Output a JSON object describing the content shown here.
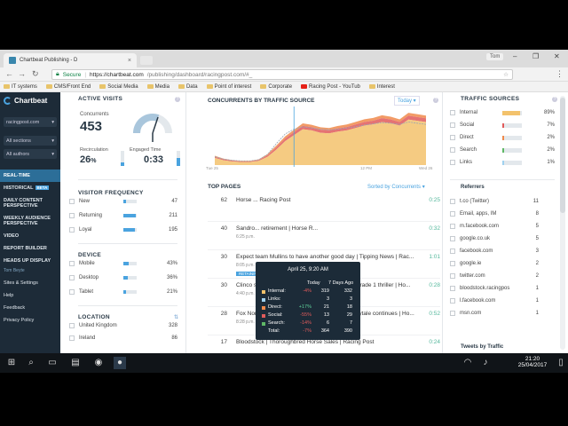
{
  "browser": {
    "tab_title": "Chartbeat Publishing - D",
    "profile": "Tom",
    "secure_label": "Secure",
    "url_domain": "https://chartbeat.com",
    "url_path": "/publishing/dashboard/racingpost.com/#_",
    "bookmarks": [
      "IT systems",
      "CMS/Front End",
      "Social Media",
      "Media",
      "Data",
      "Point of interest",
      "Corporate",
      "Racing Post - YouTub",
      "Interest"
    ]
  },
  "nav": {
    "logo": "Chartbeat",
    "site_select": "racingpost.com",
    "sections_select": "All sections",
    "authors_select": "All authors",
    "items": {
      "realtime": "REAL-TIME",
      "historical": "HISTORICAL",
      "historical_badge": "BETA",
      "daily": "DAILY CONTENT PERSPECTIVE",
      "weekly": "WEEKLY AUDIENCE PERSPECTIVE",
      "video": "VIDEO",
      "report": "REPORT BUILDER",
      "headsup": "HEADS UP DISPLAY",
      "tourbeta": "Tom Beyte",
      "sites": "Sites & Settings",
      "help": "Help",
      "feedback": "Feedback",
      "privacy": "Privacy Policy"
    }
  },
  "active_visits": {
    "title": "ACTIVE VISITS",
    "concurrents_label": "Concurrents",
    "concurrents": "453",
    "recirc_label": "Recirculation",
    "recirc": "26",
    "recirc_unit": "%",
    "engaged_label": "Engaged Time",
    "engaged": "0:33",
    "recirc_level": 0.26,
    "engaged_level": 0.55
  },
  "visitor_frequency": {
    "title": "VISITOR FREQUENCY",
    "rows": [
      {
        "label": "New",
        "value": "47",
        "level": 0.22
      },
      {
        "label": "Returning",
        "value": "211",
        "level": 0.95
      },
      {
        "label": "Loyal",
        "value": "195",
        "level": 0.88
      }
    ]
  },
  "device": {
    "title": "DEVICE",
    "rows": [
      {
        "label": "Mobile",
        "value": "43%",
        "level": 0.43
      },
      {
        "label": "Desktop",
        "value": "36%",
        "level": 0.36
      },
      {
        "label": "Tablet",
        "value": "21%",
        "level": 0.21
      }
    ]
  },
  "location": {
    "title": "LOCATION",
    "rows": [
      {
        "label": "United Kingdom",
        "value": "328"
      },
      {
        "label": "Ireland",
        "value": "86"
      }
    ]
  },
  "chart": {
    "title": "CONCURRENTS BY TRAFFIC SOURCE",
    "range_select": "Today",
    "ticks": [
      "Tue 25",
      "12 PM",
      "Wed 26"
    ]
  },
  "chart_data": {
    "type": "area",
    "xlabel": "",
    "ylabel": "",
    "x": [
      0,
      1,
      2,
      3,
      4,
      5,
      6,
      7,
      8,
      9,
      10,
      11,
      12,
      13,
      14,
      15,
      16,
      17,
      18,
      19,
      20,
      21,
      22,
      23,
      24
    ],
    "series": [
      {
        "name": "Internal",
        "values": [
          60,
          40,
          30,
          25,
          25,
          35,
          70,
          130,
          200,
          250,
          300,
          290,
          270,
          265,
          280,
          290,
          310,
          330,
          340,
          360,
          350,
          330,
          380,
          370,
          360
        ]
      },
      {
        "name": "Social",
        "values": [
          10,
          8,
          6,
          5,
          5,
          7,
          12,
          18,
          22,
          25,
          28,
          27,
          26,
          26,
          27,
          28,
          29,
          30,
          31,
          32,
          31,
          30,
          33,
          32,
          31
        ]
      },
      {
        "name": "Direct",
        "values": [
          8,
          6,
          5,
          4,
          4,
          6,
          10,
          15,
          18,
          20,
          21,
          20,
          20,
          19,
          20,
          21,
          22,
          23,
          23,
          24,
          23,
          22,
          24,
          24,
          23
        ]
      }
    ],
    "seven_day_avg": [
      70,
      50,
      40,
      35,
      35,
      45,
      90,
      180,
      260,
      300,
      320,
      310,
      300,
      295,
      300,
      310,
      320,
      335,
      345,
      355,
      350,
      340,
      360,
      350,
      340
    ]
  },
  "tooltip": {
    "title": "April 25, 9:20 AM",
    "col_today": "Today",
    "col_7day": "7 Days Ago",
    "rows": [
      {
        "name": "Internal:",
        "change": "-4%",
        "today": "319",
        "ago": "332",
        "color": "#f3c26c",
        "change_color": "#e05b5b"
      },
      {
        "name": "Links:",
        "change": "",
        "today": "3",
        "ago": "3",
        "color": "#9fd1f0",
        "change_color": "#ffffff"
      },
      {
        "name": "Direct:",
        "change": "+17%",
        "today": "21",
        "ago": "18",
        "color": "#f08a4b",
        "change_color": "#5fd39b"
      },
      {
        "name": "Social:",
        "change": "-55%",
        "today": "13",
        "ago": "29",
        "color": "#e05b5b",
        "change_color": "#e05b5b"
      },
      {
        "name": "Search:",
        "change": "-14%",
        "today": "6",
        "ago": "7",
        "color": "#5fb866",
        "change_color": "#e05b5b"
      },
      {
        "name": "Total:",
        "change": "-7%",
        "today": "364",
        "ago": "390",
        "color": "transparent",
        "change_color": "#e05b5b"
      }
    ]
  },
  "top_pages": {
    "title": "TOP PAGES",
    "sort_label": "Sorted by Concurrents",
    "articles": [
      {
        "conc": "62",
        "title": "Horse ... Racing Post",
        "meta": "",
        "eng": "0:25",
        "pill": ""
      },
      {
        "conc": "40",
        "title": "Sandro... retirement | Horse R...",
        "meta": "6:25 p.m.",
        "eng": "0:32",
        "pill": ""
      },
      {
        "conc": "30",
        "title": "Expect team Mullins to have another good day | Tipping News | Rac...",
        "meta": "8:05 p.m.",
        "eng": "1:01",
        "pill": "RETAINING"
      },
      {
        "conc": "30",
        "title": "Clinco strikes as Labaik refuses to take part in Grade 1 thriller | Ho...",
        "meta": "4:40 p.m.",
        "eng": "0:28",
        "pill": ""
      },
      {
        "conc": "28",
        "title": "Fox Norton topples Un De Sceaux as Power fairytale continues | Ho...",
        "meta": "8:28 p.m.",
        "eng": "0:52",
        "pill": ""
      },
      {
        "conc": "17",
        "title": "Bloodstock | Thoroughbred Horse Sales | Racing Post",
        "meta": "",
        "eng": "0:24",
        "pill": ""
      }
    ]
  },
  "traffic_sources": {
    "title": "TRAFFIC SOURCES",
    "rows": [
      {
        "label": "Internal",
        "value": "89%",
        "level": 0.89,
        "color": "#f3c26c"
      },
      {
        "label": "Social",
        "value": "7%",
        "level": 0.07,
        "color": "#e05b5b"
      },
      {
        "label": "Direct",
        "value": "2%",
        "level": 0.02,
        "color": "#f08a4b"
      },
      {
        "label": "Search",
        "value": "2%",
        "level": 0.02,
        "color": "#5fb866"
      },
      {
        "label": "Links",
        "value": "1%",
        "level": 0.01,
        "color": "#9fd1f0"
      }
    ],
    "referrers_title": "Referrers",
    "referrers": [
      {
        "label": "t.co (Twitter)",
        "value": "11"
      },
      {
        "label": "Email, apps, IM",
        "value": "8"
      },
      {
        "label": "m.facebook.com",
        "value": "5"
      },
      {
        "label": "google.co.uk",
        "value": "5"
      },
      {
        "label": "facebook.com",
        "value": "3"
      },
      {
        "label": "google.ie",
        "value": "2"
      },
      {
        "label": "twitter.com",
        "value": "2"
      },
      {
        "label": "bloodstock.racingpos",
        "value": "1"
      },
      {
        "label": "l.facebook.com",
        "value": "1"
      },
      {
        "label": "msn.com",
        "value": "1"
      }
    ],
    "tweets_title": "Tweets by Traffic"
  },
  "taskbar": {
    "time": "21:20",
    "date": "25/04/2017"
  }
}
